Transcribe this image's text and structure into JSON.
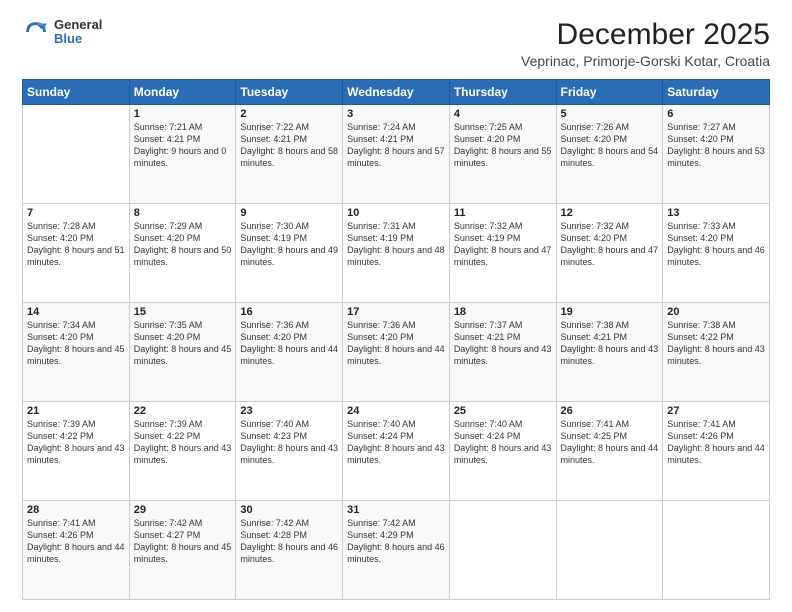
{
  "logo": {
    "general": "General",
    "blue": "Blue"
  },
  "title": "December 2025",
  "subtitle": "Veprinac, Primorje-Gorski Kotar, Croatia",
  "days_of_week": [
    "Sunday",
    "Monday",
    "Tuesday",
    "Wednesday",
    "Thursday",
    "Friday",
    "Saturday"
  ],
  "weeks": [
    [
      {
        "day": "",
        "sunrise": "",
        "sunset": "",
        "daylight": ""
      },
      {
        "day": "1",
        "sunrise": "Sunrise: 7:21 AM",
        "sunset": "Sunset: 4:21 PM",
        "daylight": "Daylight: 9 hours and 0 minutes."
      },
      {
        "day": "2",
        "sunrise": "Sunrise: 7:22 AM",
        "sunset": "Sunset: 4:21 PM",
        "daylight": "Daylight: 8 hours and 58 minutes."
      },
      {
        "day": "3",
        "sunrise": "Sunrise: 7:24 AM",
        "sunset": "Sunset: 4:21 PM",
        "daylight": "Daylight: 8 hours and 57 minutes."
      },
      {
        "day": "4",
        "sunrise": "Sunrise: 7:25 AM",
        "sunset": "Sunset: 4:20 PM",
        "daylight": "Daylight: 8 hours and 55 minutes."
      },
      {
        "day": "5",
        "sunrise": "Sunrise: 7:26 AM",
        "sunset": "Sunset: 4:20 PM",
        "daylight": "Daylight: 8 hours and 54 minutes."
      },
      {
        "day": "6",
        "sunrise": "Sunrise: 7:27 AM",
        "sunset": "Sunset: 4:20 PM",
        "daylight": "Daylight: 8 hours and 53 minutes."
      }
    ],
    [
      {
        "day": "7",
        "sunrise": "Sunrise: 7:28 AM",
        "sunset": "Sunset: 4:20 PM",
        "daylight": "Daylight: 8 hours and 51 minutes."
      },
      {
        "day": "8",
        "sunrise": "Sunrise: 7:29 AM",
        "sunset": "Sunset: 4:20 PM",
        "daylight": "Daylight: 8 hours and 50 minutes."
      },
      {
        "day": "9",
        "sunrise": "Sunrise: 7:30 AM",
        "sunset": "Sunset: 4:19 PM",
        "daylight": "Daylight: 8 hours and 49 minutes."
      },
      {
        "day": "10",
        "sunrise": "Sunrise: 7:31 AM",
        "sunset": "Sunset: 4:19 PM",
        "daylight": "Daylight: 8 hours and 48 minutes."
      },
      {
        "day": "11",
        "sunrise": "Sunrise: 7:32 AM",
        "sunset": "Sunset: 4:19 PM",
        "daylight": "Daylight: 8 hours and 47 minutes."
      },
      {
        "day": "12",
        "sunrise": "Sunrise: 7:32 AM",
        "sunset": "Sunset: 4:20 PM",
        "daylight": "Daylight: 8 hours and 47 minutes."
      },
      {
        "day": "13",
        "sunrise": "Sunrise: 7:33 AM",
        "sunset": "Sunset: 4:20 PM",
        "daylight": "Daylight: 8 hours and 46 minutes."
      }
    ],
    [
      {
        "day": "14",
        "sunrise": "Sunrise: 7:34 AM",
        "sunset": "Sunset: 4:20 PM",
        "daylight": "Daylight: 8 hours and 45 minutes."
      },
      {
        "day": "15",
        "sunrise": "Sunrise: 7:35 AM",
        "sunset": "Sunset: 4:20 PM",
        "daylight": "Daylight: 8 hours and 45 minutes."
      },
      {
        "day": "16",
        "sunrise": "Sunrise: 7:36 AM",
        "sunset": "Sunset: 4:20 PM",
        "daylight": "Daylight: 8 hours and 44 minutes."
      },
      {
        "day": "17",
        "sunrise": "Sunrise: 7:36 AM",
        "sunset": "Sunset: 4:20 PM",
        "daylight": "Daylight: 8 hours and 44 minutes."
      },
      {
        "day": "18",
        "sunrise": "Sunrise: 7:37 AM",
        "sunset": "Sunset: 4:21 PM",
        "daylight": "Daylight: 8 hours and 43 minutes."
      },
      {
        "day": "19",
        "sunrise": "Sunrise: 7:38 AM",
        "sunset": "Sunset: 4:21 PM",
        "daylight": "Daylight: 8 hours and 43 minutes."
      },
      {
        "day": "20",
        "sunrise": "Sunrise: 7:38 AM",
        "sunset": "Sunset: 4:22 PM",
        "daylight": "Daylight: 8 hours and 43 minutes."
      }
    ],
    [
      {
        "day": "21",
        "sunrise": "Sunrise: 7:39 AM",
        "sunset": "Sunset: 4:22 PM",
        "daylight": "Daylight: 8 hours and 43 minutes."
      },
      {
        "day": "22",
        "sunrise": "Sunrise: 7:39 AM",
        "sunset": "Sunset: 4:22 PM",
        "daylight": "Daylight: 8 hours and 43 minutes."
      },
      {
        "day": "23",
        "sunrise": "Sunrise: 7:40 AM",
        "sunset": "Sunset: 4:23 PM",
        "daylight": "Daylight: 8 hours and 43 minutes."
      },
      {
        "day": "24",
        "sunrise": "Sunrise: 7:40 AM",
        "sunset": "Sunset: 4:24 PM",
        "daylight": "Daylight: 8 hours and 43 minutes."
      },
      {
        "day": "25",
        "sunrise": "Sunrise: 7:40 AM",
        "sunset": "Sunset: 4:24 PM",
        "daylight": "Daylight: 8 hours and 43 minutes."
      },
      {
        "day": "26",
        "sunrise": "Sunrise: 7:41 AM",
        "sunset": "Sunset: 4:25 PM",
        "daylight": "Daylight: 8 hours and 44 minutes."
      },
      {
        "day": "27",
        "sunrise": "Sunrise: 7:41 AM",
        "sunset": "Sunset: 4:26 PM",
        "daylight": "Daylight: 8 hours and 44 minutes."
      }
    ],
    [
      {
        "day": "28",
        "sunrise": "Sunrise: 7:41 AM",
        "sunset": "Sunset: 4:26 PM",
        "daylight": "Daylight: 8 hours and 44 minutes."
      },
      {
        "day": "29",
        "sunrise": "Sunrise: 7:42 AM",
        "sunset": "Sunset: 4:27 PM",
        "daylight": "Daylight: 8 hours and 45 minutes."
      },
      {
        "day": "30",
        "sunrise": "Sunrise: 7:42 AM",
        "sunset": "Sunset: 4:28 PM",
        "daylight": "Daylight: 8 hours and 46 minutes."
      },
      {
        "day": "31",
        "sunrise": "Sunrise: 7:42 AM",
        "sunset": "Sunset: 4:29 PM",
        "daylight": "Daylight: 8 hours and 46 minutes."
      },
      {
        "day": "",
        "sunrise": "",
        "sunset": "",
        "daylight": ""
      },
      {
        "day": "",
        "sunrise": "",
        "sunset": "",
        "daylight": ""
      },
      {
        "day": "",
        "sunrise": "",
        "sunset": "",
        "daylight": ""
      }
    ]
  ]
}
